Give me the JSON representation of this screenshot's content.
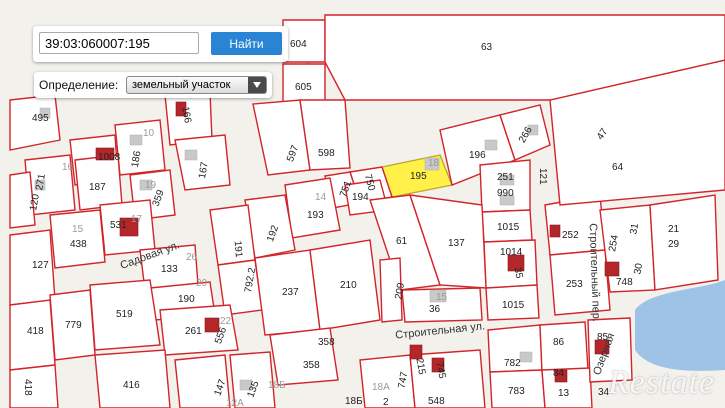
{
  "search": {
    "value": "39:03:060007:195",
    "button_label": "Найти"
  },
  "definition": {
    "label": "Определение:",
    "selected": "земельный участок"
  },
  "streets": {
    "sadovaya": "Садовая ул.",
    "stroitelnaya": "Строительная ул.",
    "stroitelny_per": "Строительный пер.",
    "ozernaya": "Озерная"
  },
  "parcel_labels": {
    "p604": "604",
    "p63": "63",
    "p605": "605",
    "p495": "495",
    "p166": "166",
    "p10": "10",
    "p186": "186",
    "p1008": "1008",
    "p16": "16",
    "p187": "187",
    "p597": "597",
    "p598": "598",
    "p167": "167",
    "p120": "120",
    "p271": "271",
    "p19": "19",
    "p359": "359",
    "p18": "18",
    "p195": "195",
    "p196": "196",
    "p266": "266",
    "p47": "47",
    "p64": "64",
    "p751": "751",
    "p750": "750",
    "p194": "194",
    "p14": "14",
    "p193": "193",
    "p251": "251",
    "p990": "990",
    "p121": "121",
    "p531": "531",
    "p17": "17",
    "p15a": "15",
    "p438": "438",
    "p192": "192",
    "p191": "191",
    "p1015a": "1015",
    "p252": "252",
    "p21": "21",
    "p29": "29",
    "p254": "254",
    "p31": "31",
    "p1014": "1014",
    "p35": "35",
    "p61": "61",
    "p137": "137",
    "p127": "127",
    "p133": "133",
    "p26": "26",
    "p190": "190",
    "p20": "20",
    "p7922": "792.2",
    "p30": "30",
    "p748": "748",
    "p253": "253",
    "p519": "519",
    "p779": "779",
    "p237": "237",
    "p210": "210",
    "p209": "209",
    "p15b": "15",
    "p36": "36",
    "p1015b": "1015",
    "p418a": "418",
    "p261": "261",
    "p22": "22",
    "p556": "556",
    "p358a": "358",
    "p358b": "358",
    "p85": "85",
    "p782": "782",
    "p86": "86",
    "p84": "84",
    "p416": "416",
    "p147": "147",
    "p135": "135",
    "p18b": "18Б",
    "p747": "747",
    "p215": "215",
    "p745": "745",
    "p783": "783",
    "p418b": "418",
    "p18a": "18А",
    "p185": "18Б",
    "p548": "548",
    "p13": "13",
    "p34": "34",
    "p12a": "12А",
    "p2": "2"
  },
  "watermark": "Restate",
  "colors": {
    "boundary": "#d2242a",
    "highlight": "#fff14a",
    "button": "#2a84d4",
    "water": "#9ec3e6"
  }
}
